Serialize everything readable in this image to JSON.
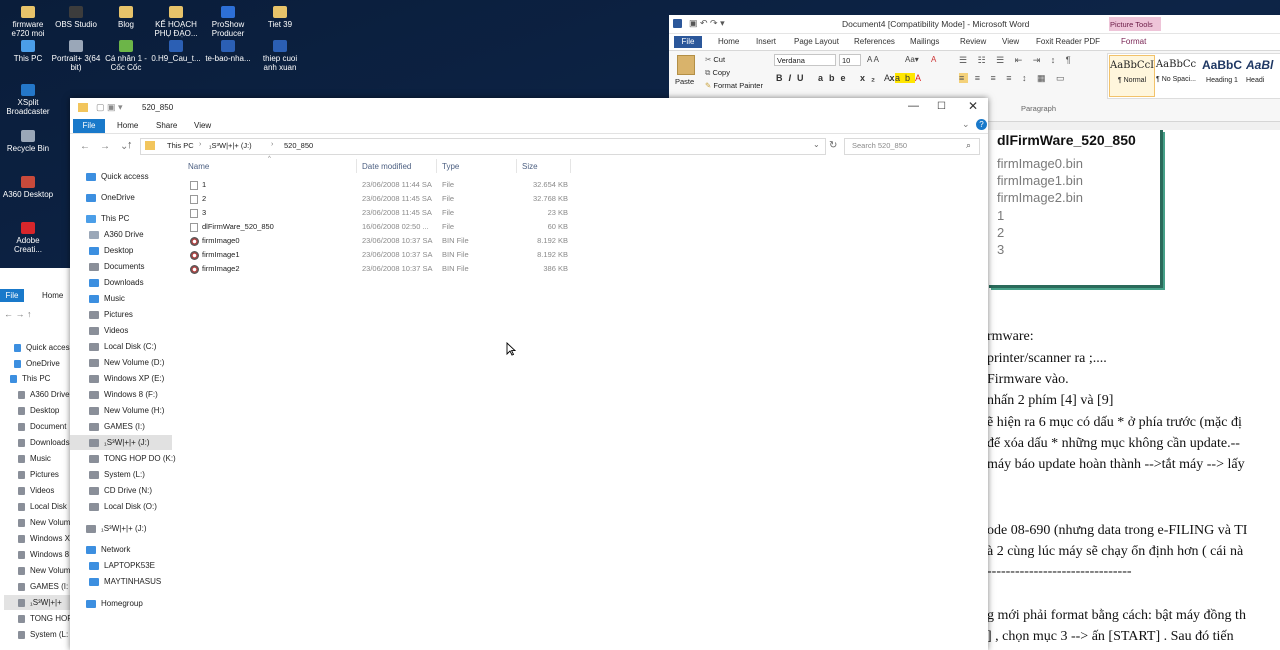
{
  "desktop": {
    "icons": [
      {
        "label": "firmware\ne720 moi",
        "color": "#e7c36a"
      },
      {
        "label": "OBS Studio",
        "color": "#3c3c3c"
      },
      {
        "label": "Blog",
        "color": "#e7c36a"
      },
      {
        "label": "KẾ HOẠCH\nPHỤ ĐẠO...",
        "color": "#e7c36a"
      },
      {
        "label": "ProShow\nProducer",
        "color": "#2d6fd6"
      },
      {
        "label": "Tiet 39",
        "color": "#e7c36a"
      },
      {
        "label": "This PC",
        "color": "#4b9ee8"
      },
      {
        "label": "Portrait+ 3(64\nbit)",
        "color": "#9aa7b8"
      },
      {
        "label": "Cá nhân 1 -\nCốc Cốc",
        "color": "#6cb548"
      },
      {
        "label": "0.H9_Cau_t...",
        "color": "#2b5fb4"
      },
      {
        "label": "te-bao-nha...",
        "color": "#2b5fb4"
      },
      {
        "label": "thiep cuoi\nanh xuan",
        "color": "#2b5fb4"
      },
      {
        "label": "XSplit\nBroadcaster",
        "color": "#2477c9"
      },
      {
        "label": "Recycle Bin",
        "color": "#9aa7b8"
      },
      {
        "label": "A360 Desktop",
        "color": "#c94a3b"
      },
      {
        "label": "Adobe\nCreati...",
        "color": "#d7262b"
      }
    ]
  },
  "word": {
    "title": "Document4 [Compatibility Mode] - Microsoft Word",
    "context_group": "Picture Tools",
    "tabs": [
      "File",
      "Home",
      "Insert",
      "Page Layout",
      "References",
      "Mailings",
      "Review",
      "View",
      "Foxit Reader PDF",
      "Format"
    ],
    "clipboard": {
      "paste": "Paste",
      "cut": "Cut",
      "copy": "Copy",
      "format_painter": "Format Painter"
    },
    "font_name": "Verdana",
    "font_size": "10",
    "paragraph_label": "Paragraph",
    "styles": [
      {
        "sample": "AaBbCcI",
        "name": "¶ Normal"
      },
      {
        "sample": "AaBbCc",
        "name": "¶ No Spaci..."
      },
      {
        "sample": "AaBbC",
        "name": "Heading 1"
      },
      {
        "sample": "AaBl",
        "name": "Headi"
      }
    ],
    "image_box": {
      "heading": "dlFirmWare_520_850",
      "items": [
        "firmImage0.bin",
        "firmImage1.bin",
        "firmImage2.bin",
        "1",
        "2",
        "3"
      ]
    },
    "doc_lines": [
      "rmware:",
      " printer/scanner ra ;....",
      "Firmware vào.",
      "nhấn 2 phím [4] và [9]",
      "ẽ hiện ra 6 mục có dấu * ở phía trước (mặc đị",
      " để xóa dấu * những mục không cần update.--",
      " máy báo update hoàn thành -->tắt máy --> lấy",
      "",
      "ode 08-690 (nhưng data trong e-FILING và TI",
      "à 2 cùng lúc máy sẽ chạy ổn định hơn ( cái nà",
      "-------------------------------",
      "",
      "g mới phải format bằng cách: bật máy đồng th",
      "] , chọn mục 3 --> ấn [START] . Sau đó tiến"
    ]
  },
  "explorer_back": {
    "tabs": [
      "File",
      "Home"
    ],
    "nav": [
      "Quick access",
      "OneDrive",
      "This PC",
      "A360 Drive",
      "Desktop",
      "Document",
      "Downloads",
      "Music",
      "Pictures",
      "Videos",
      "Local Disk",
      "New Volum",
      "Windows X",
      "Windows 8",
      "New Volum",
      "GAMES (I:",
      "₁S³W|+|+",
      "TONG HOP",
      "System (L:"
    ]
  },
  "explorer": {
    "title": "520_850",
    "tabs": [
      "File",
      "Home",
      "Share",
      "View"
    ],
    "breadcrumb": [
      "This PC",
      "₁S³W|+|+ (J:)",
      "520_850"
    ],
    "search_placeholder": "Search 520_850",
    "columns": [
      "Name",
      "Date modified",
      "Type",
      "Size"
    ],
    "files": [
      {
        "name": "1",
        "date": "23/06/2008 11:44 SA",
        "type": "File",
        "size": "32.654 KB",
        "icon": "file"
      },
      {
        "name": "2",
        "date": "23/06/2008 11:45 SA",
        "type": "File",
        "size": "32.768 KB",
        "icon": "file"
      },
      {
        "name": "3",
        "date": "23/06/2008 11:45 SA",
        "type": "File",
        "size": "23 KB",
        "icon": "file"
      },
      {
        "name": "dlFirmWare_520_850",
        "date": "16/06/2008 02:50 ...",
        "type": "File",
        "size": "60 KB",
        "icon": "file"
      },
      {
        "name": "firmImage0",
        "date": "23/06/2008 10:37 SA",
        "type": "BIN File",
        "size": "8.192 KB",
        "icon": "bin"
      },
      {
        "name": "firmImage1",
        "date": "23/06/2008 10:37 SA",
        "type": "BIN File",
        "size": "8.192 KB",
        "icon": "bin"
      },
      {
        "name": "firmImage2",
        "date": "23/06/2008 10:37 SA",
        "type": "BIN File",
        "size": "386 KB",
        "icon": "bin"
      }
    ],
    "nav": [
      {
        "label": "Quick access",
        "color": "#3c8fe0",
        "group": true
      },
      {
        "label": "OneDrive",
        "color": "#3c8fe0",
        "group": true
      },
      {
        "label": "This PC",
        "color": "#4b9ee8",
        "group": true
      },
      {
        "label": "A360 Drive",
        "color": "#9aa7b8"
      },
      {
        "label": "Desktop",
        "color": "#3c8fe0"
      },
      {
        "label": "Documents",
        "color": "#8a8f99"
      },
      {
        "label": "Downloads",
        "color": "#3c8fe0"
      },
      {
        "label": "Music",
        "color": "#3c8fe0"
      },
      {
        "label": "Pictures",
        "color": "#8a8f99"
      },
      {
        "label": "Videos",
        "color": "#8a8f99"
      },
      {
        "label": "Local Disk (C:)",
        "color": "#8a8f99"
      },
      {
        "label": "New Volume (D:)",
        "color": "#8a8f99"
      },
      {
        "label": "Windows XP (E:)",
        "color": "#8a8f99"
      },
      {
        "label": "Windows 8 (F:)",
        "color": "#8a8f99"
      },
      {
        "label": "New Volume (H:)",
        "color": "#8a8f99"
      },
      {
        "label": "GAMES  (I:)",
        "color": "#8a8f99"
      },
      {
        "label": "₁S³W|+|+ (J:)",
        "color": "#8a8f99",
        "selected": true
      },
      {
        "label": "TONG HOP DO (K:)",
        "color": "#8a8f99"
      },
      {
        "label": "System (L:)",
        "color": "#8a8f99"
      },
      {
        "label": "CD Drive (N:)",
        "color": "#8a8f99"
      },
      {
        "label": "Local Disk (O:)",
        "color": "#8a8f99"
      },
      {
        "label": "₁S³W|+|+ (J:)",
        "color": "#8a8f99",
        "group": true
      },
      {
        "label": "Network",
        "color": "#3c8fe0",
        "group": true
      },
      {
        "label": "LAPTOPK53E",
        "color": "#3c8fe0"
      },
      {
        "label": "MAYTINHASUS",
        "color": "#3c8fe0"
      },
      {
        "label": "Homegroup",
        "color": "#3c8fe0",
        "group": true
      }
    ]
  },
  "colors": {
    "accent": "#1979ca",
    "word_blue": "#2b579a",
    "selected_nav": "#cce8ff"
  }
}
